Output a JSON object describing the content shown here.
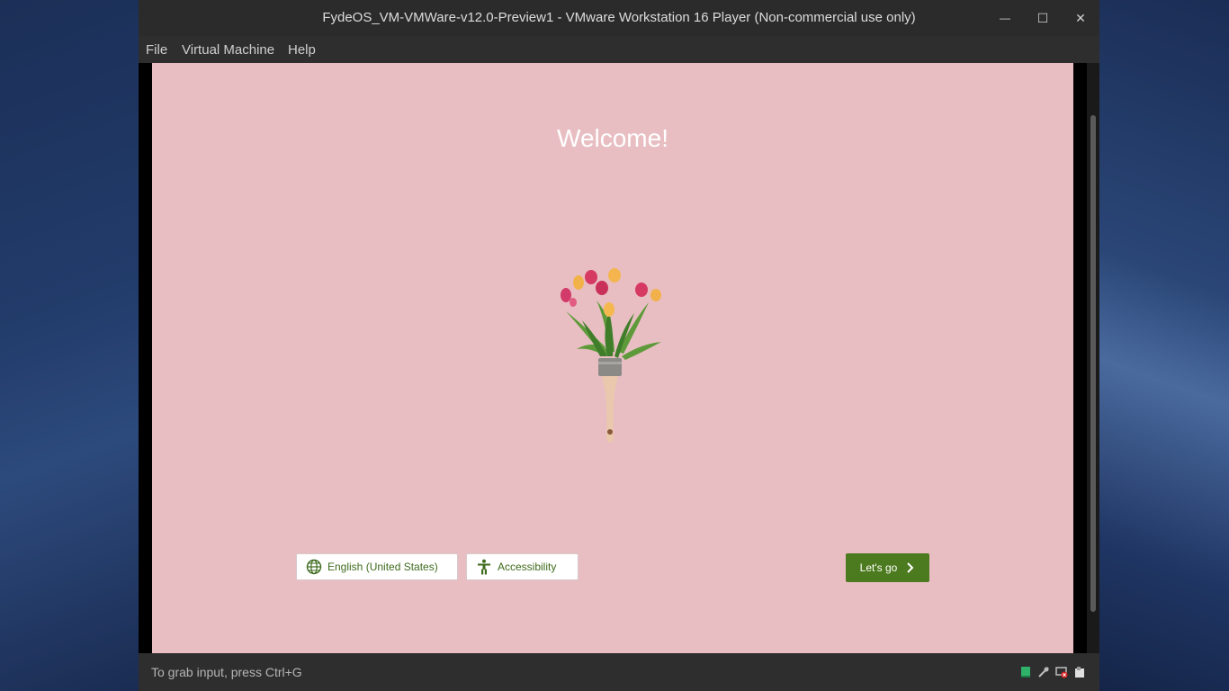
{
  "window": {
    "title": "FydeOS_VM-VMWare-v12.0-Preview1 - VMware Workstation 16 Player (Non-commercial use only)",
    "controls": {
      "minimize": "—",
      "maximize": "☐",
      "close": "✕"
    }
  },
  "menubar": {
    "items": [
      "File",
      "Virtual Machine",
      "Help"
    ]
  },
  "vm": {
    "heading": "Welcome!",
    "language_label": "English (United States)",
    "accessibility_label": "Accessibility",
    "next_label": "Let's go",
    "background_color": "#e8bec2",
    "accent_color": "#4c7a1e"
  },
  "statusbar": {
    "hint": "To grab input, press Ctrl+G",
    "device_icons": [
      "hard-disk-icon",
      "network-icon",
      "display-disconnected-icon",
      "removable-device-icon"
    ]
  }
}
